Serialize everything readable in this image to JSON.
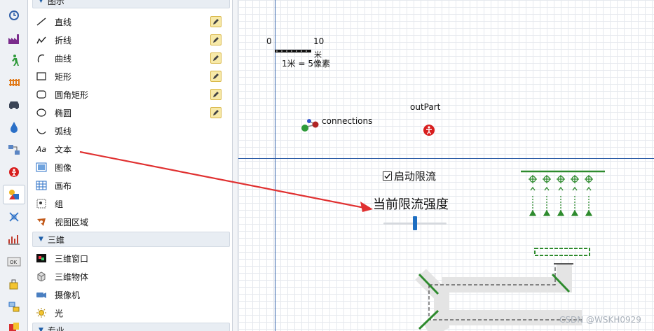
{
  "palette": {
    "header_top": "图示",
    "items": [
      {
        "label": "直线",
        "icon": "line-icon",
        "editable": true
      },
      {
        "label": "折线",
        "icon": "polyline-icon",
        "editable": true
      },
      {
        "label": "曲线",
        "icon": "curve-icon",
        "editable": true
      },
      {
        "label": "矩形",
        "icon": "rectangle-icon",
        "editable": true
      },
      {
        "label": "圆角矩形",
        "icon": "rounded-rectangle-icon",
        "editable": true
      },
      {
        "label": "椭圆",
        "icon": "ellipse-icon",
        "editable": true
      },
      {
        "label": "弧线",
        "icon": "arc-icon",
        "editable": false
      },
      {
        "label": "文本",
        "icon": "text-icon",
        "icon_text": "Aa",
        "editable": false
      },
      {
        "label": "图像",
        "icon": "image-icon",
        "editable": false
      },
      {
        "label": "画布",
        "icon": "canvas-icon",
        "editable": false
      },
      {
        "label": "组",
        "icon": "group-icon",
        "editable": false
      },
      {
        "label": "视图区域",
        "icon": "viewarea-icon",
        "editable": false
      }
    ],
    "section_3d": {
      "title": "三维",
      "items": [
        {
          "label": "三维窗口",
          "icon": "3d-window-icon"
        },
        {
          "label": "三维物体",
          "icon": "3d-object-icon"
        },
        {
          "label": "摄像机",
          "icon": "camera-icon"
        },
        {
          "label": "光",
          "icon": "light-icon"
        }
      ]
    },
    "section_bottom": {
      "title": "专业"
    }
  },
  "icon_strip": [
    "process-modeling-icon",
    "factory-icon",
    "pedestrian-icon",
    "rail-icon",
    "road-traffic-icon",
    "fluid-icon",
    "material-handling-icon",
    "agent-icon",
    "presentation-icon",
    "space-markup-icon",
    "analysis-icon",
    "controls-icon",
    "connectivity-icon",
    "system-dynamics-icon",
    "pictures-icon"
  ],
  "canvas": {
    "scale": {
      "left_label": "0",
      "right_label": "10",
      "unit": "米",
      "ratio": "1米 = 5像素"
    },
    "connections_label": "connections",
    "outpart_label": "outPart",
    "checkbox_label": "启动限流",
    "checkbox_checked": true,
    "slider_title": "当前限流强度",
    "slider_value": 0.5,
    "watermark": "CSDN @WSKH0929"
  },
  "colors": {
    "arrow": "#e03030",
    "axis": "#2f5fa8",
    "conveyor": "#2e8b2e",
    "outpart": "#d81e1e",
    "slider_thumb": "#1f6fc2"
  }
}
